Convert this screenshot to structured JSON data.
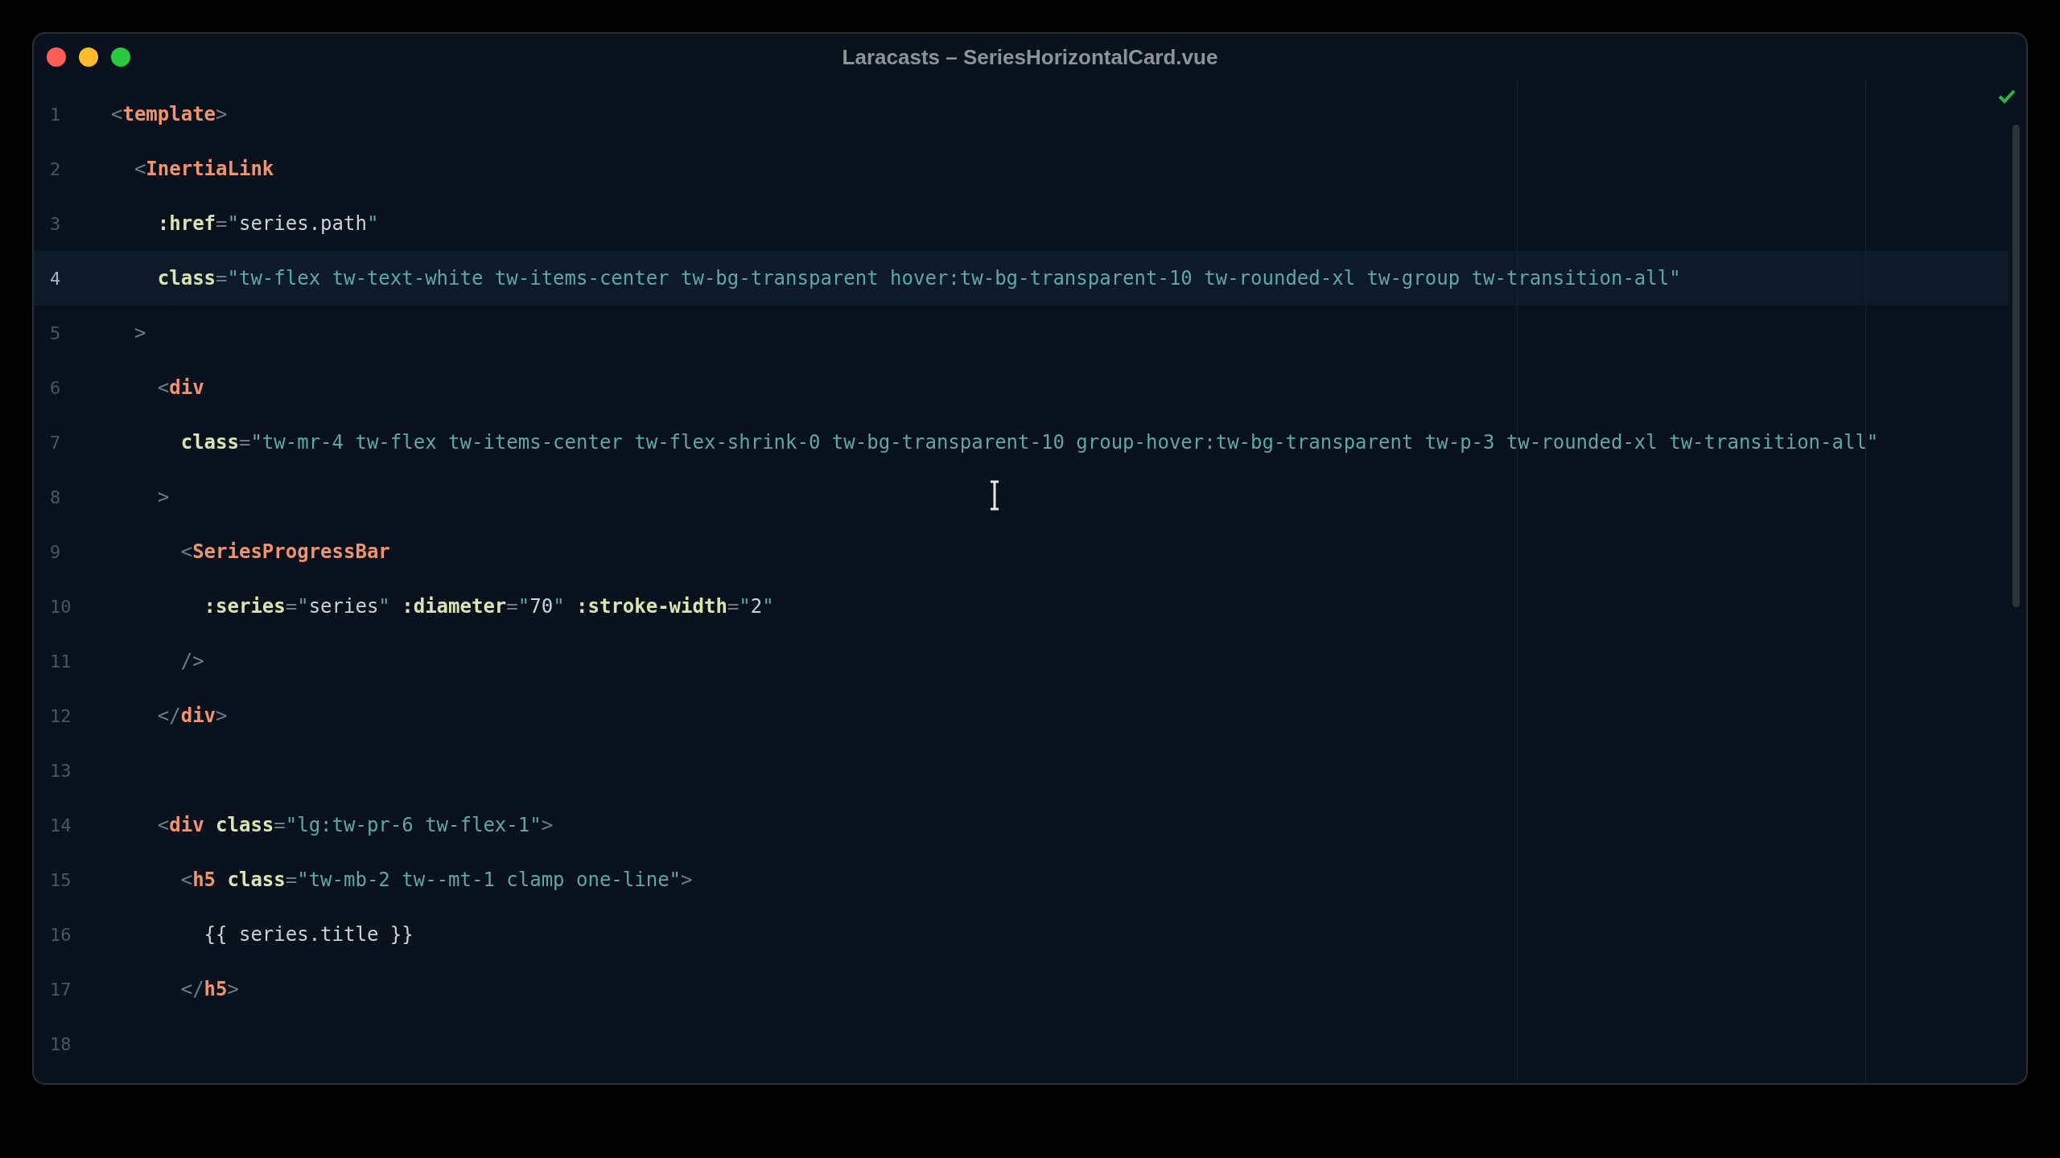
{
  "window": {
    "title": "Laracasts – SeriesHorizontalCard.vue"
  },
  "editor": {
    "lines": [
      {
        "number": "1",
        "current": false,
        "tokens": [
          {
            "punct": "<"
          },
          {
            "tag": "template"
          },
          {
            "punct": ">"
          }
        ]
      },
      {
        "number": "2",
        "current": false,
        "tokens": [
          {
            "punct": "  <"
          },
          {
            "tag": "InertiaLink"
          }
        ]
      },
      {
        "number": "3",
        "current": false,
        "tokens": [
          {
            "attr": "    :href"
          },
          {
            "punct": "="
          },
          {
            "string": "\""
          },
          {
            "plain": "series.path"
          },
          {
            "string": "\""
          }
        ]
      },
      {
        "number": "4",
        "current": true,
        "tokens": [
          {
            "attr": "    class"
          },
          {
            "punct": "="
          },
          {
            "string": "\"tw-flex tw-text-white tw-items-center tw-bg-transparent hover:tw-bg-transparent-10 tw-rounded-xl tw-group tw-transition-all\""
          }
        ]
      },
      {
        "number": "5",
        "current": false,
        "tokens": [
          {
            "punct": "  >"
          }
        ]
      },
      {
        "number": "6",
        "current": false,
        "tokens": [
          {
            "punct": "    <"
          },
          {
            "tag": "div"
          }
        ]
      },
      {
        "number": "7",
        "current": false,
        "tokens": [
          {
            "attr": "      class"
          },
          {
            "punct": "="
          },
          {
            "string": "\"tw-mr-4 tw-flex tw-items-center tw-flex-shrink-0 tw-bg-transparent-10 group-hover:tw-bg-transparent tw-p-3 tw-rounded-xl tw-transition-all\""
          }
        ]
      },
      {
        "number": "8",
        "current": false,
        "tokens": [
          {
            "punct": "    >"
          }
        ]
      },
      {
        "number": "9",
        "current": false,
        "tokens": [
          {
            "punct": "      <"
          },
          {
            "tag": "SeriesProgressBar"
          }
        ]
      },
      {
        "number": "10",
        "current": false,
        "tokens": [
          {
            "attr": "        :series"
          },
          {
            "punct": "="
          },
          {
            "string": "\""
          },
          {
            "plain": "series"
          },
          {
            "string": "\""
          },
          {
            "attr": " :diameter"
          },
          {
            "punct": "="
          },
          {
            "string": "\""
          },
          {
            "plain": "70"
          },
          {
            "string": "\""
          },
          {
            "attr": " :stroke-width"
          },
          {
            "punct": "="
          },
          {
            "string": "\""
          },
          {
            "plain": "2"
          },
          {
            "string": "\""
          }
        ]
      },
      {
        "number": "11",
        "current": false,
        "tokens": [
          {
            "punct": "      />"
          }
        ]
      },
      {
        "number": "12",
        "current": false,
        "tokens": [
          {
            "punct": "    </"
          },
          {
            "tag": "div"
          },
          {
            "punct": ">"
          }
        ]
      },
      {
        "number": "13",
        "current": false
      },
      {
        "number": "14",
        "current": false,
        "tokens": [
          {
            "punct": "    <"
          },
          {
            "tag": "div"
          },
          {
            "attr": " class"
          },
          {
            "punct": "="
          },
          {
            "string": "\"lg:tw-pr-6 tw-flex-1\""
          },
          {
            "punct": ">"
          }
        ]
      },
      {
        "number": "15",
        "current": false,
        "tokens": [
          {
            "punct": "      <"
          },
          {
            "tag": "h5"
          },
          {
            "attr": " class"
          },
          {
            "punct": "="
          },
          {
            "string": "\"tw-mb-2 tw--mt-1 clamp one-line\""
          },
          {
            "punct": ">"
          }
        ]
      },
      {
        "number": "16",
        "current": false,
        "tokens": [
          {
            "plain": "        {{ series.title }}"
          }
        ]
      },
      {
        "number": "17",
        "current": false,
        "tokens": [
          {
            "punct": "      </"
          },
          {
            "tag": "h5"
          },
          {
            "punct": ">"
          }
        ]
      },
      {
        "number": "18",
        "current": false
      }
    ]
  }
}
